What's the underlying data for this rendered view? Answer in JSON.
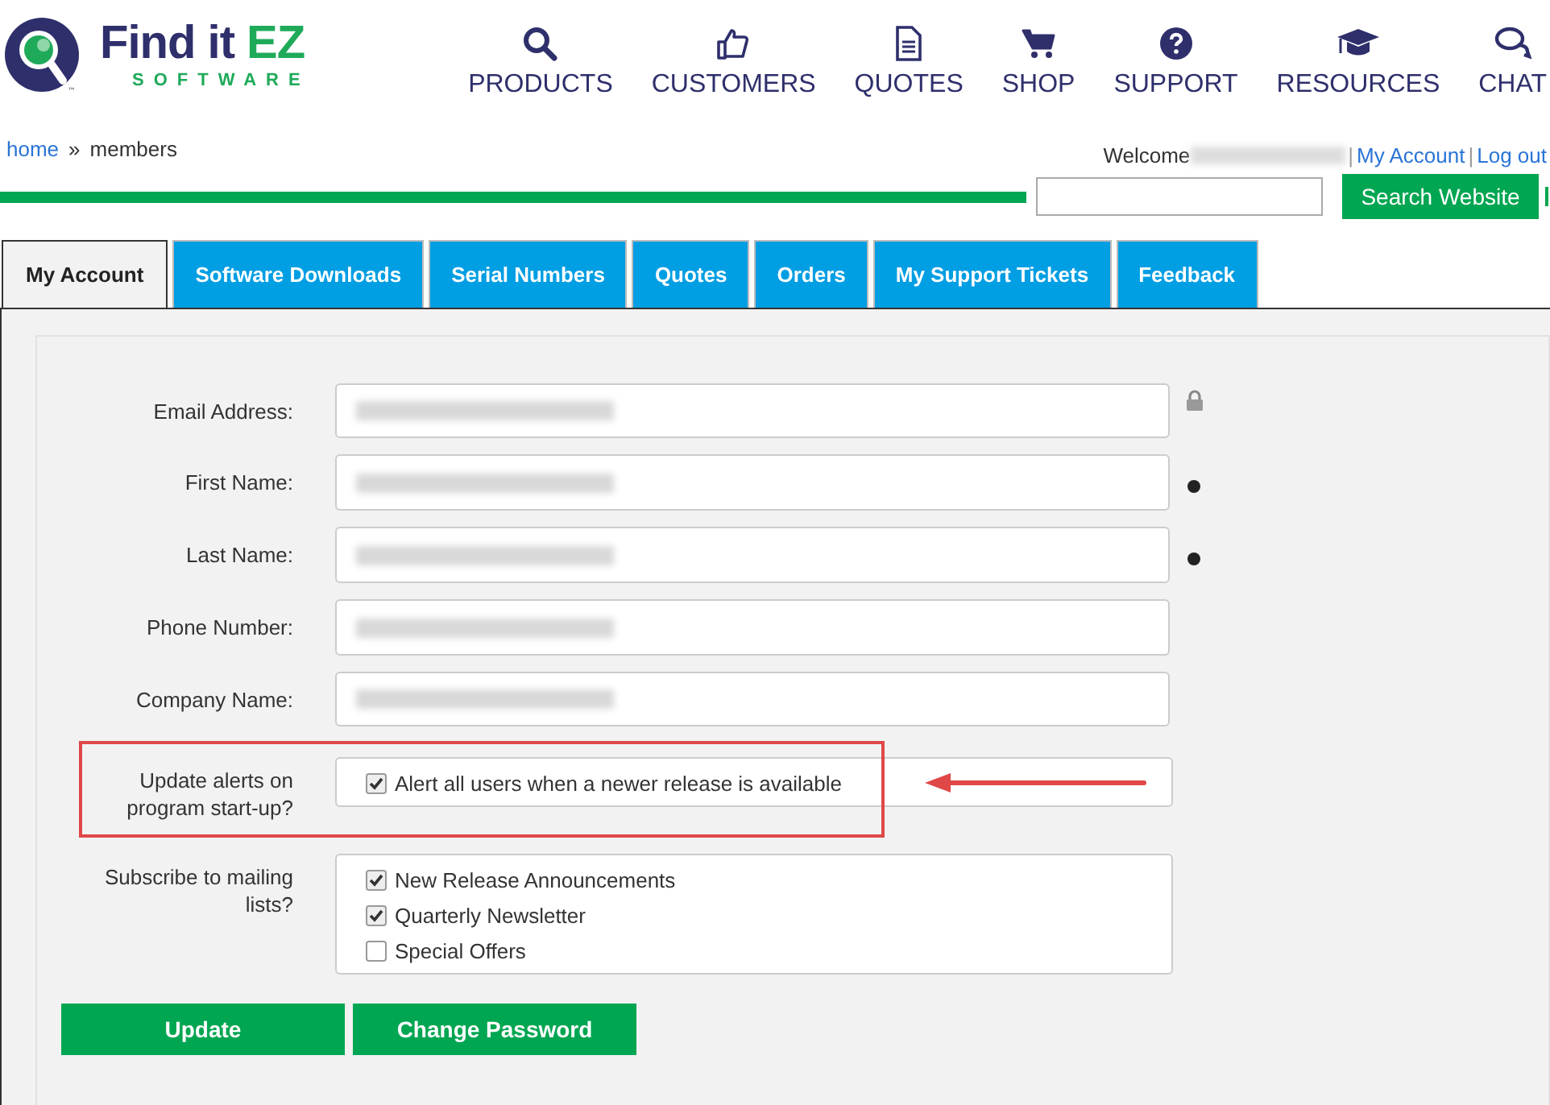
{
  "logo": {
    "name": "Find it",
    "accent": "EZ",
    "tagline": "SOFTWARE",
    "trademark": "™"
  },
  "nav": [
    {
      "kind": "search",
      "label": "PRODUCTS"
    },
    {
      "kind": "thumb",
      "label": "CUSTOMERS"
    },
    {
      "kind": "document",
      "label": "QUOTES"
    },
    {
      "kind": "cart",
      "label": "SHOP"
    },
    {
      "kind": "question",
      "label": "SUPPORT"
    },
    {
      "kind": "cap",
      "label": "RESOURCES"
    },
    {
      "kind": "chat",
      "label": "CHAT"
    }
  ],
  "breadcrumb": {
    "links": [
      "home"
    ],
    "separator": "»",
    "current": "members"
  },
  "account_bar": {
    "welcome": "Welcome",
    "name_redacted": true,
    "separator": "|",
    "links": [
      "My Account",
      "Log out"
    ]
  },
  "search": {
    "button": "Search Website"
  },
  "tabs": [
    {
      "label": "My Account",
      "selected": true
    },
    {
      "label": "Software Downloads",
      "selected": false
    },
    {
      "label": "Serial Numbers",
      "selected": false
    },
    {
      "label": "Quotes",
      "selected": false
    },
    {
      "label": "Orders",
      "selected": false
    },
    {
      "label": "My Support Tickets",
      "selected": false
    },
    {
      "label": "Feedback",
      "selected": false
    }
  ],
  "form": [
    {
      "kind": "text",
      "label": "Email Address:",
      "redacted": true,
      "locked": true
    },
    {
      "kind": "text",
      "label": "First Name:",
      "redacted": true,
      "required": true
    },
    {
      "kind": "text",
      "label": "Last Name:",
      "redacted": true,
      "required": true
    },
    {
      "kind": "text",
      "label": "Phone Number:",
      "redacted": true
    },
    {
      "kind": "text",
      "label": "Company Name:",
      "redacted": true
    },
    {
      "kind": "checks",
      "label": "Update alerts on program start-up?",
      "highlighted": true,
      "options": [
        {
          "label": "Alert all users when a newer release is available",
          "checked": true
        }
      ]
    },
    {
      "kind": "checks",
      "label": "Subscribe to mailing lists?",
      "options": [
        {
          "label": "New Release Announcements",
          "checked": true
        },
        {
          "label": "Quarterly Newsletter",
          "checked": true
        },
        {
          "label": "Special Offers",
          "checked": false
        }
      ]
    }
  ],
  "buttons": [
    "Update",
    "Change Password"
  ]
}
